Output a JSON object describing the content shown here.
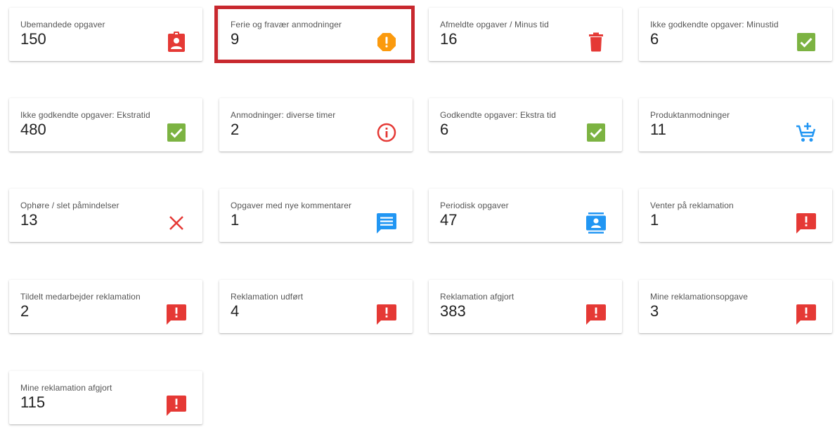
{
  "colors": {
    "red": "#e53935",
    "orange": "#fb9a0e",
    "green": "#7cb342",
    "blue": "#2196f3",
    "highlight": "#c8282e"
  },
  "cards": [
    {
      "label": "Ubemandede opgaver",
      "value": "150",
      "icon": "assignment-ind-icon"
    },
    {
      "label": "Ferie og fravær anmodninger",
      "value": "9",
      "icon": "report-octagon-icon"
    },
    {
      "label": "Afmeldte opgaver / Minus tid",
      "value": "16",
      "icon": "trash-icon"
    },
    {
      "label": "Ikke godkendte opgaver: Minustid",
      "value": "6",
      "icon": "check-box-icon"
    },
    {
      "label": "Ikke godkendte opgaver: Ekstratid",
      "value": "480",
      "icon": "check-box-icon"
    },
    {
      "label": "Anmodninger: diverse timer",
      "value": "2",
      "icon": "info-icon"
    },
    {
      "label": "Godkendte opgaver: Ekstra tid",
      "value": "6",
      "icon": "check-box-icon"
    },
    {
      "label": "Produktanmodninger",
      "value": "11",
      "icon": "add-cart-icon"
    },
    {
      "label": "Ophøre / slet påmindelser",
      "value": "13",
      "icon": "close-icon"
    },
    {
      "label": "Opgaver med nye kommentarer",
      "value": "1",
      "icon": "comment-icon"
    },
    {
      "label": "Periodisk opgaver",
      "value": "47",
      "icon": "contacts-icon"
    },
    {
      "label": "Venter på reklamation",
      "value": "1",
      "icon": "feedback-icon"
    },
    {
      "label": "Tildelt medarbejder reklamation",
      "value": "2",
      "icon": "feedback-icon"
    },
    {
      "label": "Reklamation udført",
      "value": "4",
      "icon": "feedback-icon"
    },
    {
      "label": "Reklamation afgjort",
      "value": "383",
      "icon": "feedback-icon"
    },
    {
      "label": "Mine reklamationsopgave",
      "value": "3",
      "icon": "feedback-icon"
    },
    {
      "label": "Mine reklamation afgjort",
      "value": "115",
      "icon": "feedback-icon"
    }
  ]
}
